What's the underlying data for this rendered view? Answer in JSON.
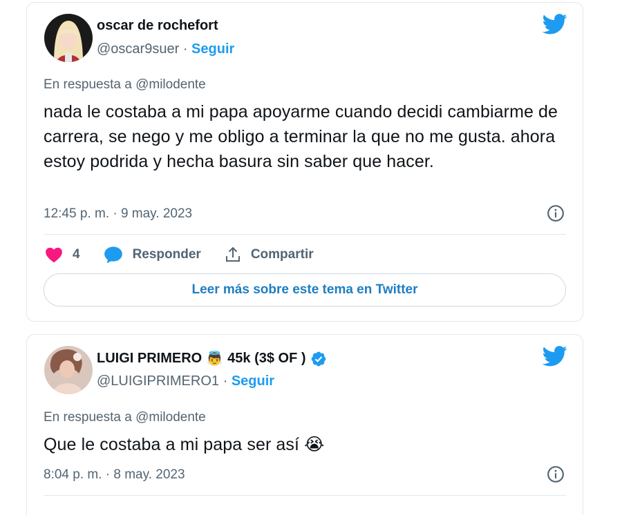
{
  "tweets": [
    {
      "author_name": "oscar de rochefort",
      "handle": "@oscar9suer",
      "separator": "·",
      "follow_label": "Seguir",
      "reply_to": "En respuesta a @milodente",
      "text": "nada le costaba a mi papa apoyarme cuando decidi cambiarme de carrera, se nego y me obligo a terminar la que no me gusta. ahora estoy podrida y hecha basura sin saber que hacer.",
      "timestamp": "12:45 p. m. · 9 may. 2023",
      "like_count": "4",
      "reply_label": "Responder",
      "share_label": "Compartir",
      "read_more_label": "Leer más sobre este tema en Twitter"
    },
    {
      "author_name": "LUIGI PRIMERO",
      "author_emoji": "👼",
      "author_suffix": "45k (3$ OF )",
      "handle": "@LUIGIPRIMERO1",
      "separator": "·",
      "follow_label": "Seguir",
      "reply_to": "En respuesta a @milodente",
      "text": "Que le costaba a mi papa ser así",
      "text_emoji": "😭",
      "timestamp": "8:04 p. m. · 8 may. 2023"
    }
  ],
  "colors": {
    "twitter_blue": "#1d9bf0",
    "like_pink": "#f91880",
    "secondary_text": "#536471",
    "border": "#e1e8ed"
  },
  "icons": [
    "twitter-bird-icon",
    "heart-icon",
    "reply-bubble-icon",
    "share-icon",
    "info-icon",
    "verified-badge-icon"
  ]
}
